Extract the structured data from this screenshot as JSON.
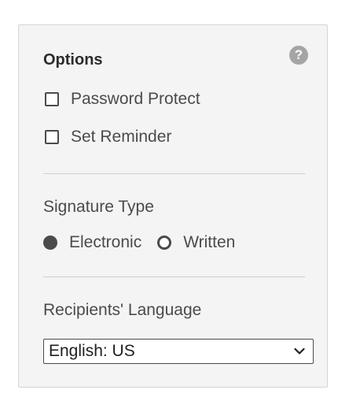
{
  "options": {
    "title": "Options",
    "help_icon": "question-mark-icon",
    "password_protect_label": "Password Protect",
    "set_reminder_label": "Set Reminder",
    "password_protect_checked": false,
    "set_reminder_checked": false
  },
  "signature_type": {
    "title": "Signature Type",
    "options": [
      {
        "label": "Electronic",
        "selected": true
      },
      {
        "label": "Written",
        "selected": false
      }
    ]
  },
  "language": {
    "title": "Recipients' Language",
    "selected": "English: US"
  },
  "colors": {
    "panel_bg": "#f4f4f4",
    "text": "#4b4b4b",
    "help_icon_bg": "#a5a5a5"
  }
}
